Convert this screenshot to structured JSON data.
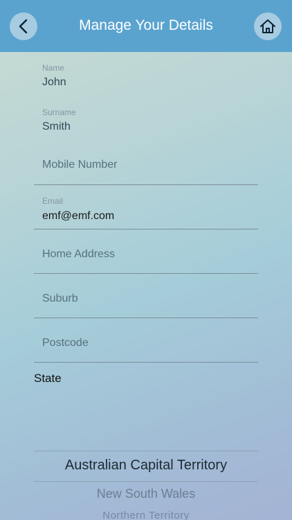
{
  "header": {
    "title": "Manage Your Details",
    "back_icon": "chevron-left-icon",
    "home_icon": "home-icon",
    "color": "#5aa3cf"
  },
  "form": {
    "name": {
      "label": "Name",
      "value": "John"
    },
    "surname": {
      "label": "Surname",
      "value": "Smith"
    },
    "mobile": {
      "placeholder": "Mobile Number"
    },
    "email": {
      "label": "Email",
      "value": "emf@emf.com"
    },
    "address": {
      "placeholder": "Home Address"
    },
    "suburb": {
      "placeholder": "Suburb"
    },
    "postcode": {
      "placeholder": "Postcode"
    },
    "state": {
      "label": "State",
      "options": [
        "Australian Capital Territory",
        "New South Wales",
        "Northern Territory"
      ],
      "selected": "Australian Capital Territory"
    }
  }
}
